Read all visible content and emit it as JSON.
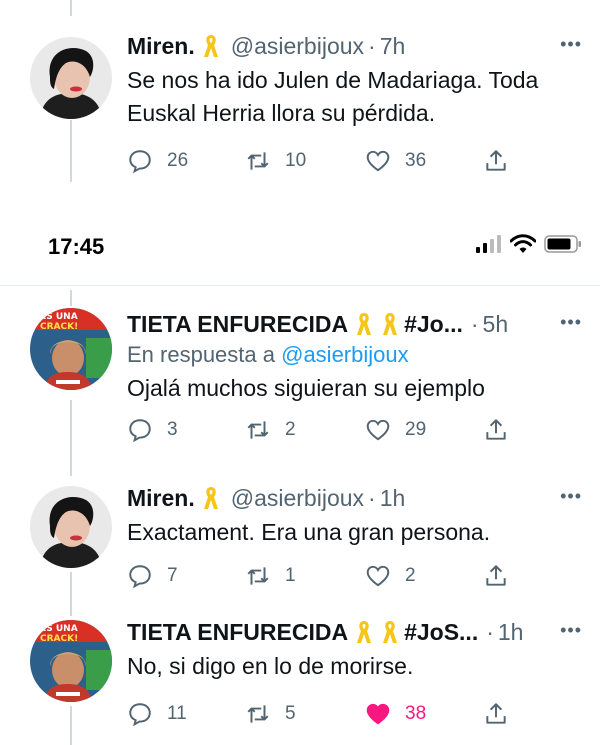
{
  "status_bar": {
    "time": "17:45"
  },
  "tweets": [
    {
      "name": "Miren.",
      "handle": "@asierbijoux",
      "dot": "·",
      "time": "7h",
      "reply_prefix": "",
      "reply_handle": "",
      "text_lines": [
        "Se nos ha ido Julen de Madariaga. Toda",
        "Euskal Herria llora su pérdida."
      ],
      "replies": "26",
      "retweets": "10",
      "likes": "36",
      "liked": false
    },
    {
      "name": "TIETA ENFURECIDA",
      "handle": "#Jo...",
      "dot": "·",
      "time": "5h",
      "reply_prefix": "En respuesta a",
      "reply_handle": "@asierbijoux",
      "text_lines": [
        "Ojalá muchos siguieran su ejemplo"
      ],
      "replies": "3",
      "retweets": "2",
      "likes": "29",
      "liked": false
    },
    {
      "name": "Miren.",
      "handle": "@asierbijoux",
      "dot": "·",
      "time": "1h",
      "reply_prefix": "",
      "reply_handle": "",
      "text_lines": [
        "Exactament. Era una gran persona."
      ],
      "replies": "7",
      "retweets": "1",
      "likes": "2",
      "liked": false
    },
    {
      "name": "TIETA ENFURECIDA",
      "handle": "#JoS...",
      "dot": "·",
      "time": "1h",
      "reply_prefix": "",
      "reply_handle": "",
      "text_lines": [
        "No, si digo en lo de morirse."
      ],
      "replies": "11",
      "retweets": "5",
      "likes": "38",
      "liked": true
    }
  ],
  "avatar_badge": {
    "line1": "¡ES UNA",
    "line2": "CRACK!"
  },
  "more_icon": "•••",
  "colors": {
    "accent": "#1d9bf0",
    "muted": "#536471",
    "like": "#f91880",
    "ribbon": "#f5c518"
  }
}
